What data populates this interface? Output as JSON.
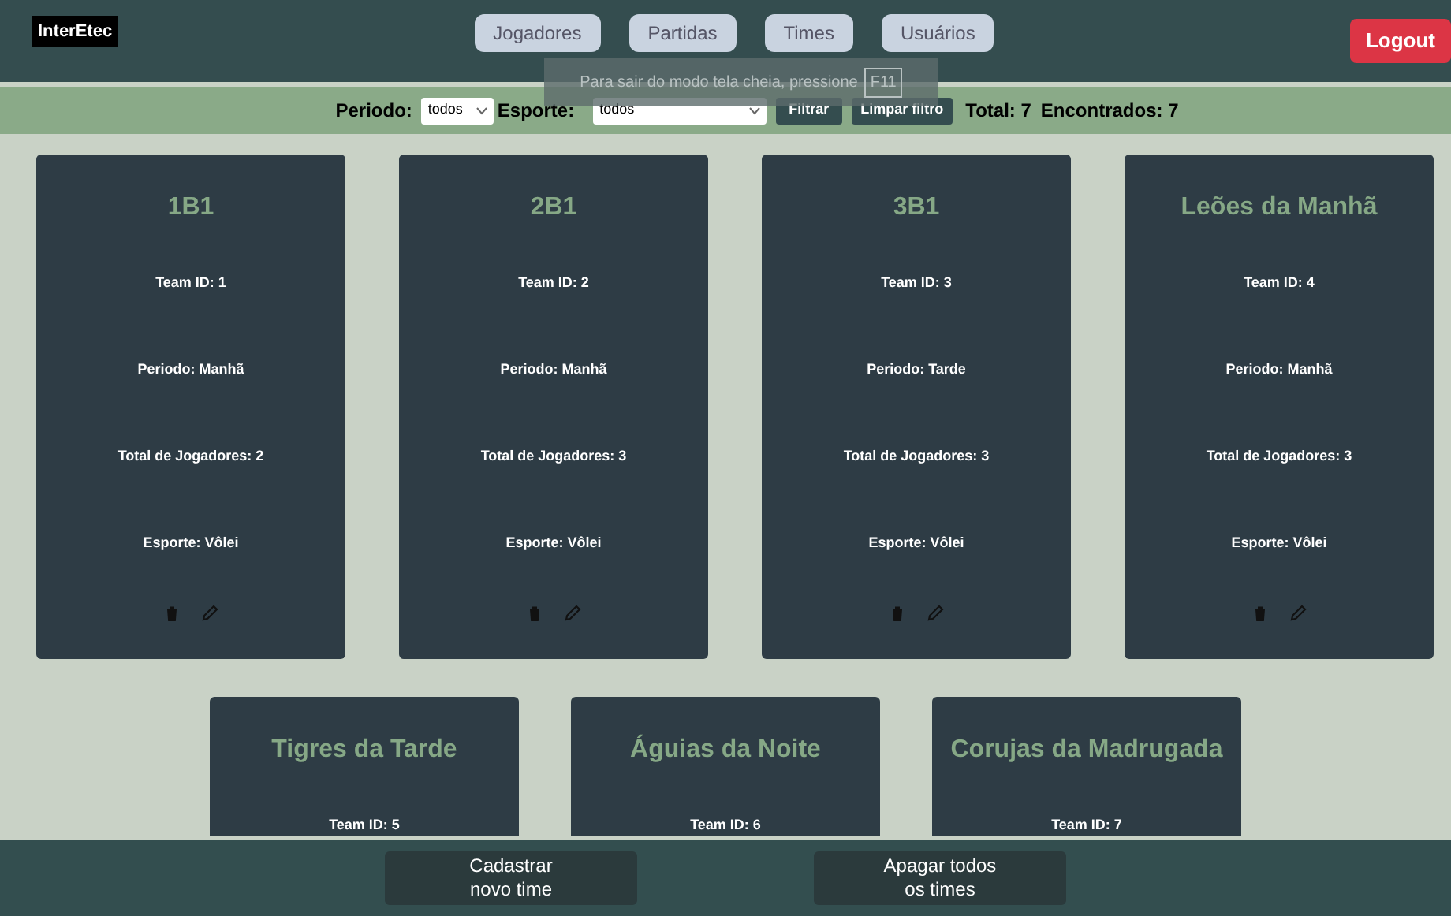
{
  "logo": "InterEtec",
  "nav": [
    {
      "label": "Jogadores"
    },
    {
      "label": "Partidas"
    },
    {
      "label": "Times"
    },
    {
      "label": "Usuários"
    }
  ],
  "logout": "Logout",
  "toast": {
    "text": "Para sair do modo tela cheia, pressione",
    "key": "F11"
  },
  "filter": {
    "periodo_label": "Periodo:",
    "periodo_value": "todos",
    "esporte_label": "Esporte:",
    "esporte_value": "todos",
    "filter_button": "Filtrar",
    "clear_button": "Limpar filtro",
    "total": "Total: 7",
    "found": "Encontrados: 7"
  },
  "cards": [
    {
      "title": "1B1",
      "fields": [
        "Team ID: 1",
        "Periodo: Manhã",
        "Total de Jogadores: 2",
        "Esporte: Vôlei"
      ]
    },
    {
      "title": "2B1",
      "fields": [
        "Team ID: 2",
        "Periodo: Manhã",
        "Total de Jogadores: 3",
        "Esporte: Vôlei"
      ]
    },
    {
      "title": "3B1",
      "fields": [
        "Team ID: 3",
        "Periodo: Tarde",
        "Total de Jogadores: 3",
        "Esporte: Vôlei"
      ]
    },
    {
      "title": "Leões da Manhã",
      "fields": [
        "Team ID: 4",
        "Periodo: Manhã",
        "Total de Jogadores: 3",
        "Esporte: Vôlei"
      ]
    },
    {
      "title": "Tigres da Tarde",
      "fields": [
        "Team ID: 5"
      ]
    },
    {
      "title": "Águias da Noite",
      "fields": [
        "Team ID: 6"
      ]
    },
    {
      "title": "Corujas da Madrugada",
      "fields": [
        "Team ID: 7"
      ]
    }
  ],
  "footer_buttons": [
    "Cadastrar novo time",
    "Apagar todos os times"
  ]
}
